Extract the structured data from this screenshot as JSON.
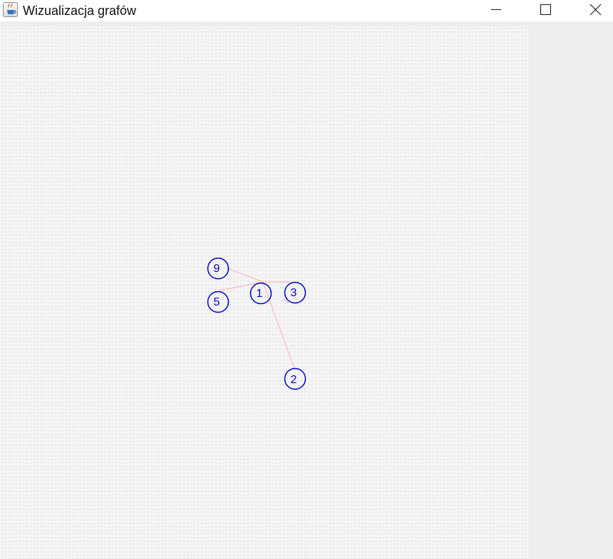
{
  "window": {
    "title": "Wizualizacja grafów"
  },
  "icons": {
    "app": "java-coffee-cup-icon",
    "minimize": "minimize-icon",
    "maximize": "maximize-icon",
    "close": "close-icon"
  },
  "colors": {
    "edge": "#ffb6c1",
    "vertex": "#0000cc",
    "canvas_background": "#eeeeee",
    "grid_line": "#f9f9f9"
  },
  "graph": {
    "vertices": [
      {
        "label": "9"
      },
      {
        "label": "5"
      },
      {
        "label": "1"
      },
      {
        "label": "3"
      },
      {
        "label": "2"
      }
    ],
    "edges": [
      {
        "from": "9",
        "to": "1"
      },
      {
        "from": "5",
        "to": "1"
      },
      {
        "from": "1",
        "to": "3"
      },
      {
        "from": "1",
        "to": "2"
      }
    ]
  }
}
